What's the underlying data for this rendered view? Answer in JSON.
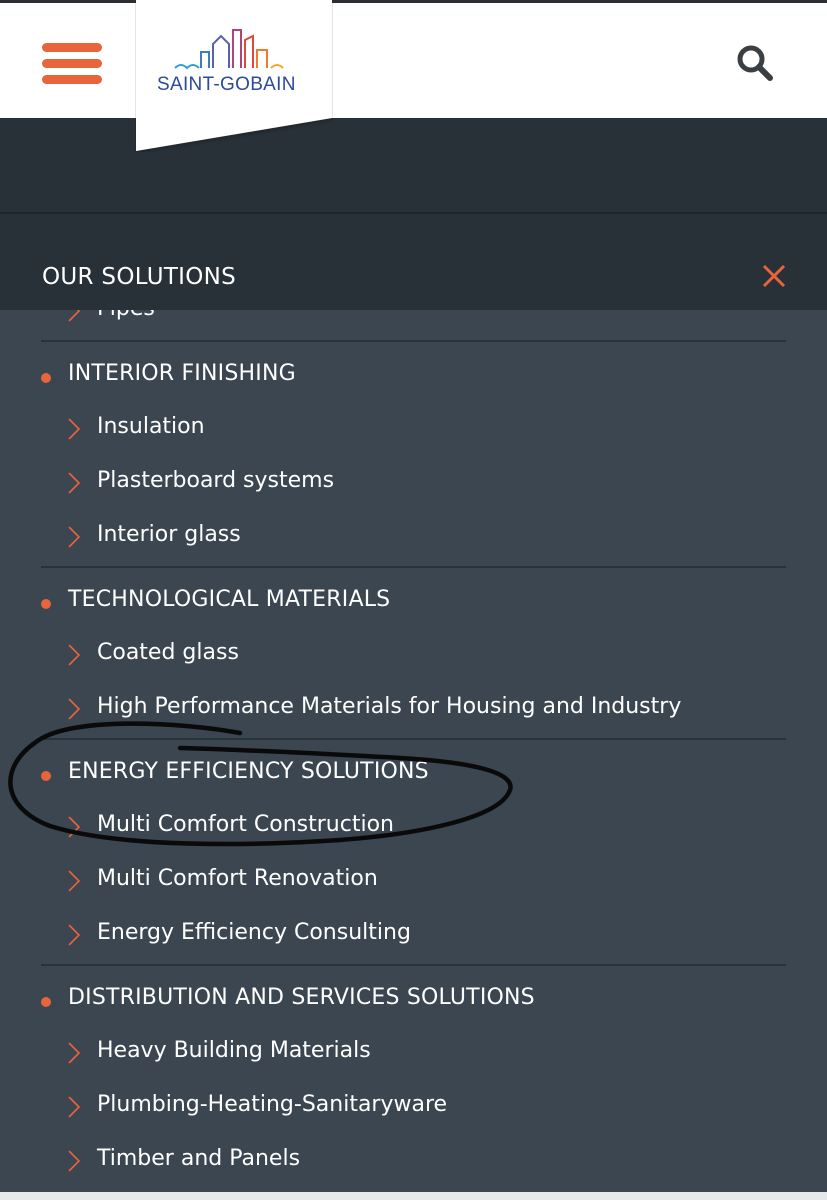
{
  "header": {
    "logo_text": "SAINT-GOBAIN",
    "menu_icon": "hamburger-menu-icon",
    "search_icon": "search-icon",
    "accent_color": "#e8643a",
    "brand_color": "#2c4a9a"
  },
  "panel": {
    "title": "OUR SOLUTIONS",
    "close_icon": "close-icon"
  },
  "menu": {
    "partial_item": "Pipes",
    "categories": [
      {
        "label": "INTERIOR FINISHING",
        "items": [
          "Insulation",
          "Plasterboard systems",
          "Interior glass"
        ]
      },
      {
        "label": "TECHNOLOGICAL MATERIALS",
        "items": [
          "Coated glass",
          "High Performance Materials for Housing and Industry"
        ]
      },
      {
        "label": "ENERGY EFFICIENCY SOLUTIONS",
        "items": [
          "Multi Comfort Construction",
          "Multi Comfort Renovation",
          "Energy Efficiency Consulting"
        ]
      },
      {
        "label": "DISTRIBUTION AND SERVICES SOLUTIONS",
        "items": [
          "Heavy Building Materials",
          "Plumbing-Heating-Sanitaryware",
          "Timber and Panels"
        ]
      }
    ]
  }
}
